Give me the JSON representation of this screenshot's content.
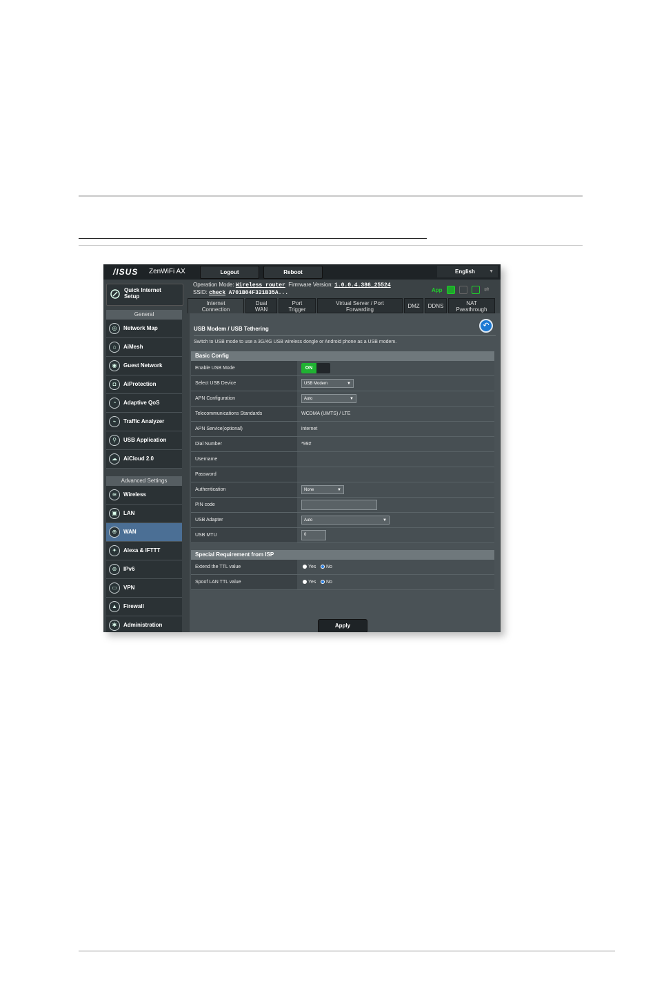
{
  "header": {
    "brand": "/ISUS",
    "model": "ZenWiFi AX",
    "logout_label": "Logout",
    "reboot_label": "Reboot",
    "language": "English"
  },
  "status": {
    "op_mode_label": "Operation Mode:",
    "op_mode_value": "Wireless router",
    "firmware_label": "Firmware Version:",
    "firmware_value": "1.0.0.4.386_25524",
    "ssid_label": "SSID:",
    "ssid_value_1": "check",
    "ssid_value_2": "A701B04F321B35A...",
    "app_label": "App"
  },
  "sidebar": {
    "qis_label_1": "Quick Internet",
    "qis_label_2": "Setup",
    "general_header": "General",
    "general_items": [
      {
        "label": "Network Map"
      },
      {
        "label": "AiMesh"
      },
      {
        "label": "Guest Network"
      },
      {
        "label": "AiProtection"
      },
      {
        "label": "Adaptive QoS"
      },
      {
        "label": "Traffic Analyzer"
      },
      {
        "label": "USB Application"
      },
      {
        "label": "AiCloud 2.0"
      }
    ],
    "advanced_header": "Advanced Settings",
    "advanced_items": [
      {
        "label": "Wireless"
      },
      {
        "label": "LAN"
      },
      {
        "label": "WAN"
      },
      {
        "label": "Alexa & IFTTT"
      },
      {
        "label": "IPv6"
      },
      {
        "label": "VPN"
      },
      {
        "label": "Firewall"
      },
      {
        "label": "Administration"
      }
    ]
  },
  "tabs": [
    {
      "line1": "Internet",
      "line2": "Connection"
    },
    {
      "line1": "Dual",
      "line2": "WAN"
    },
    {
      "line1": "Port",
      "line2": "Trigger"
    },
    {
      "line1": "Virtual Server / Port",
      "line2": "Forwarding"
    },
    {
      "line1": "DMZ",
      "line2": ""
    },
    {
      "line1": "DDNS",
      "line2": ""
    },
    {
      "line1": "NAT",
      "line2": "Passthrough"
    }
  ],
  "panel": {
    "title": "USB Modem / USB Tethering",
    "description": "Switch to USB mode to use a 3G/4G USB wireless dongle or Android phone as a USB modem.",
    "basic_config_header": "Basic Config",
    "special_header": "Special Requirement from ISP",
    "apply_label": "Apply"
  },
  "basic_rows": [
    {
      "label": "Enable USB Mode",
      "value": "ON"
    },
    {
      "label": "Select USB Device",
      "value": "USB Modem"
    },
    {
      "label": "APN Configuration",
      "value": "Auto"
    },
    {
      "label": "Telecommunications Standards",
      "value": "WCDMA (UMTS) / LTE"
    },
    {
      "label": "APN Service(optional)",
      "value": "internet"
    },
    {
      "label": "Dial Number",
      "value": "*99#"
    },
    {
      "label": "Username",
      "value": ""
    },
    {
      "label": "Password",
      "value": ""
    },
    {
      "label": "Authentication",
      "value": "None"
    },
    {
      "label": "PIN code",
      "value": ""
    },
    {
      "label": "USB Adapter",
      "value": "Auto"
    },
    {
      "label": "USB MTU",
      "value": "0"
    }
  ],
  "special_rows": [
    {
      "label": "Extend the TTL value",
      "yes": "Yes",
      "no": "No",
      "selected": "No"
    },
    {
      "label": "Spoof LAN TTL value",
      "yes": "Yes",
      "no": "No",
      "selected": "No"
    }
  ],
  "colors": {
    "accent_green": "#20b232",
    "active_nav": "#4b6f95",
    "back_button": "#1c79d3"
  }
}
